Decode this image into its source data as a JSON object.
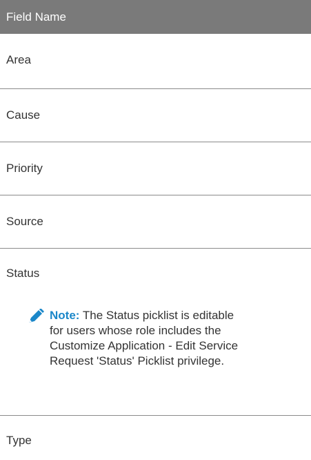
{
  "table": {
    "header": "Field Name",
    "rows": [
      {
        "field": "Area"
      },
      {
        "field": "Cause"
      },
      {
        "field": "Priority"
      },
      {
        "field": "Source"
      },
      {
        "field": "Status"
      },
      {
        "field": "Type"
      }
    ],
    "note": {
      "icon": "pencil-icon",
      "label": "Note:",
      "text": " The Status picklist is editable for users whose role includes the Customize Application - Edit Service Request 'Status' Picklist privilege."
    }
  },
  "colors": {
    "header_bg": "#7a7a7a",
    "note_accent": "#1b87c9",
    "body_text": "#333333"
  }
}
